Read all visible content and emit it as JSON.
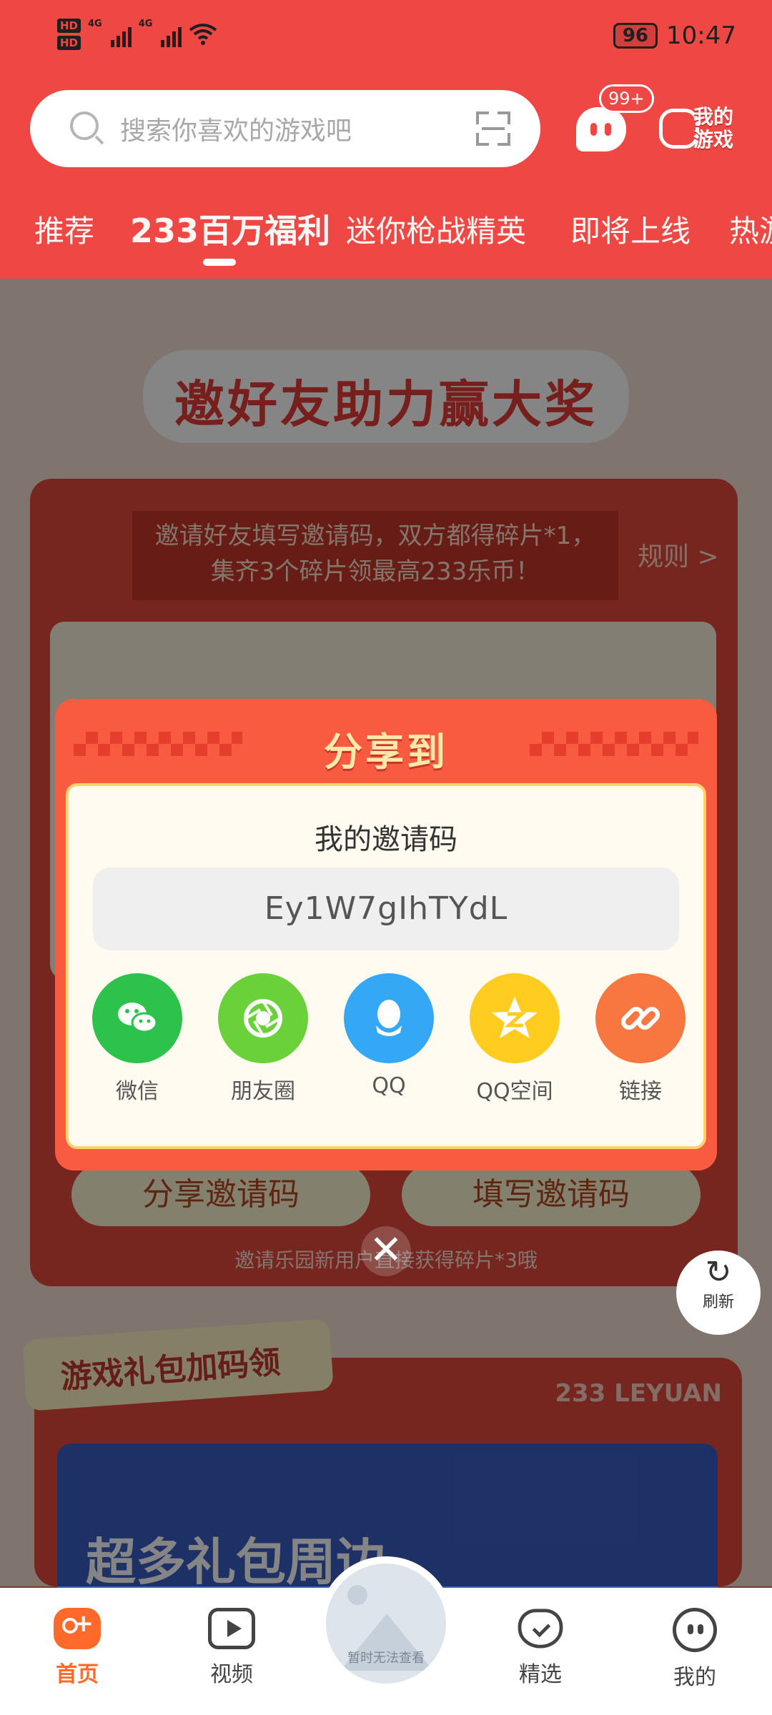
{
  "status_bar": {
    "hd1": "HD",
    "hd2": "HD",
    "net1": "4G",
    "net2": "4G",
    "battery": "96",
    "time": "10:47"
  },
  "header": {
    "search_placeholder": "搜索你喜欢的游戏吧",
    "message_badge": "99+",
    "my_games_label": "我的游戏",
    "tabs": [
      "推荐",
      "233百万福利",
      "迷你枪战精英",
      "即将上线",
      "热游"
    ],
    "active_tab": 1
  },
  "page": {
    "hero_title": "邀好友助力赢大奖",
    "banner_text": "邀请好友填写邀请码，双方都得碎片*1，集齐3个碎片领最高233乐币！",
    "rules_link": "规则 >",
    "share_code_button": "分享邀请码",
    "fill_code_button": "填写邀请码",
    "tip": "邀请乐园新用户直接获得碎片*3哦",
    "gift_tag": "游戏礼包加码领",
    "gift_brand": "233 LEYUAN",
    "gift_banner_text": "超多礼包周边",
    "refresh_label": "刷新"
  },
  "dialog": {
    "title": "分享到",
    "code_label": "我的邀请码",
    "invite_code": "Ey1W7gIhTYdL",
    "share_options": [
      {
        "label": "微信",
        "icon": "wechat-icon",
        "color": "#2cc24b"
      },
      {
        "label": "朋友圈",
        "icon": "moments-icon",
        "color": "#6ad13a"
      },
      {
        "label": "QQ",
        "icon": "qq-icon",
        "color": "#35a8f5"
      },
      {
        "label": "QQ空间",
        "icon": "qzone-icon",
        "color": "#ffcc1f"
      },
      {
        "label": "链接",
        "icon": "link-icon",
        "color": "#f8763f"
      }
    ],
    "close_symbol": "✕"
  },
  "bottom_nav": {
    "items": [
      {
        "label": "首页",
        "icon": "home-gamepad-icon"
      },
      {
        "label": "视频",
        "icon": "video-icon"
      },
      {
        "label": "精选",
        "icon": "heart-icon"
      },
      {
        "label": "我的",
        "icon": "profile-icon"
      }
    ],
    "center_caption": "暂时无法查看",
    "active_index": 0
  },
  "colors": {
    "header_red": "#ef4744",
    "dialog_orange": "#f85b3f",
    "active_nav": "#ff6a2b"
  }
}
